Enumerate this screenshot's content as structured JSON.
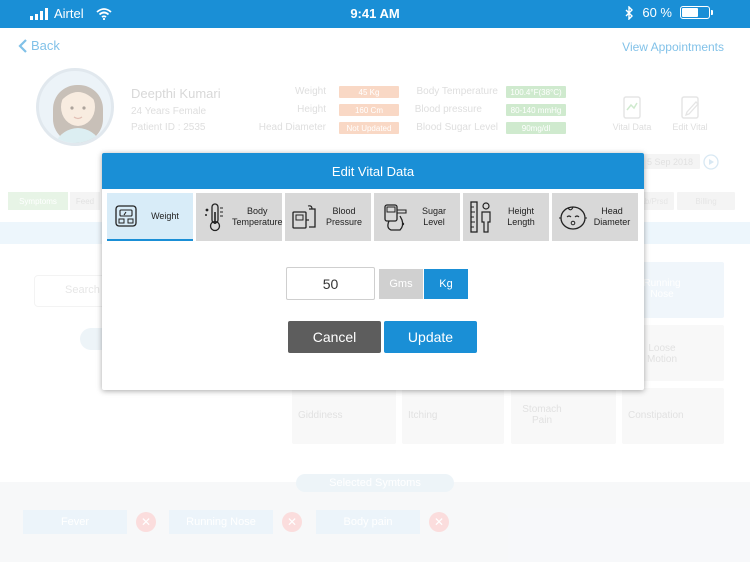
{
  "status_bar": {
    "carrier": "Airtel",
    "time": "9:41 AM",
    "battery": "60 %"
  },
  "nav": {
    "back_label": "Back",
    "right_label": "View Appointments"
  },
  "patient": {
    "name": "Deepthi Kumari",
    "age_gender": "24 Years Female",
    "patient_id": "Patient ID : 2535"
  },
  "vitals_labels": {
    "weight": "Weight",
    "height": "Height",
    "head_diameter": "Head Diameter",
    "body_temperature": "Body Temperature",
    "blood_pressure": "Blood pressure",
    "blood_sugar": "Blood Sugar Level"
  },
  "vitals_values": {
    "weight": "45 Kg",
    "height": "160 Cm",
    "head_diameter": "Not Updated",
    "body_temperature": "100.4°F(38°C)",
    "blood_pressure": "80-140 mmHg",
    "blood_sugar": "90mg/dl"
  },
  "header_actions": {
    "vital_data": "Vital Data",
    "edit_vital": "Edit Vital"
  },
  "date_label": "5 Sep 2018",
  "tabs": {
    "symptoms": "Symptoms",
    "second": "Feed",
    "lab": "Lab/Prsd",
    "billing": "Billing"
  },
  "search_placeholder": "Search",
  "symptom_tiles": {
    "running_nose": "Running Nose",
    "loose_motion": "Loose Motion",
    "giddiness": "Giddiness",
    "itching": "Itching",
    "stomach_pain": "Stomach Pain",
    "constipation": "Constipation"
  },
  "selected": {
    "label": "Selected Symtoms",
    "items": [
      "Fever",
      "Running Nose",
      "Body pain"
    ]
  },
  "modal": {
    "title": "Edit Vital Data",
    "tabs": [
      {
        "label": "Weight",
        "icon": "weighing-scale-icon"
      },
      {
        "label": "Body Temperature",
        "icon": "thermometer-icon"
      },
      {
        "label": "Blood Pressure",
        "icon": "blood-pressure-icon"
      },
      {
        "label": "Sugar Level",
        "icon": "glucometer-icon"
      },
      {
        "label": "Height Length",
        "icon": "height-icon"
      },
      {
        "label": "Head Diameter",
        "icon": "baby-head-icon"
      }
    ],
    "value": "50",
    "units": {
      "gms": "Gms",
      "kg": "Kg"
    },
    "cancel_label": "Cancel",
    "update_label": "Update"
  },
  "colors": {
    "primary": "#1a8fd6",
    "cancel": "#5d5d5d",
    "active_tab": "#d8ecf8"
  }
}
